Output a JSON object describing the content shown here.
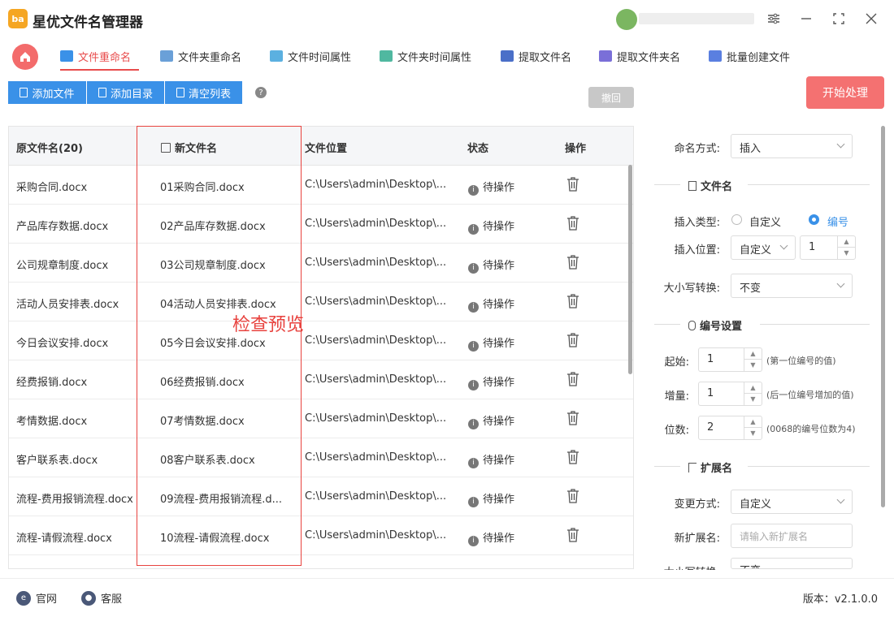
{
  "app": {
    "title": "星优文件名管理器",
    "logo_text": "ba"
  },
  "tabs": [
    {
      "label": "文件重命名",
      "color": "#3a91e8"
    },
    {
      "label": "文件夹重命名",
      "color": "#6aa0d8"
    },
    {
      "label": "文件时间属性",
      "color": "#5bb0e0"
    },
    {
      "label": "文件夹时间属性",
      "color": "#50b8a0"
    },
    {
      "label": "提取文件名",
      "color": "#4a6fc8"
    },
    {
      "label": "提取文件夹名",
      "color": "#7a6fd8"
    },
    {
      "label": "批量创建文件",
      "color": "#5a7fe0"
    }
  ],
  "toolbar": {
    "add_file": "添加文件",
    "add_dir": "添加目录",
    "clear_list": "清空列表",
    "help": "?",
    "undo": "撤回",
    "start": "开始处理"
  },
  "table": {
    "headers": {
      "original": "原文件名(20)",
      "new": "新文件名",
      "location": "文件位置",
      "status": "状态",
      "action": "操作"
    },
    "rows": [
      {
        "original": "采购合同.docx",
        "new": "01采购合同.docx",
        "location": "C:\\Users\\admin\\Desktop\\...",
        "status": "待操作"
      },
      {
        "original": "产品库存数据.docx",
        "new": "02产品库存数据.docx",
        "location": "C:\\Users\\admin\\Desktop\\...",
        "status": "待操作"
      },
      {
        "original": "公司规章制度.docx",
        "new": "03公司规章制度.docx",
        "location": "C:\\Users\\admin\\Desktop\\...",
        "status": "待操作"
      },
      {
        "original": "活动人员安排表.docx",
        "new": "04活动人员安排表.docx",
        "location": "C:\\Users\\admin\\Desktop\\...",
        "status": "待操作"
      },
      {
        "original": "今日会议安排.docx",
        "new": "05今日会议安排.docx",
        "location": "C:\\Users\\admin\\Desktop\\...",
        "status": "待操作"
      },
      {
        "original": "经费报销.docx",
        "new": "06经费报销.docx",
        "location": "C:\\Users\\admin\\Desktop\\...",
        "status": "待操作"
      },
      {
        "original": "考情数据.docx",
        "new": "07考情数据.docx",
        "location": "C:\\Users\\admin\\Desktop\\...",
        "status": "待操作"
      },
      {
        "original": "客户联系表.docx",
        "new": "08客户联系表.docx",
        "location": "C:\\Users\\admin\\Desktop\\...",
        "status": "待操作"
      },
      {
        "original": "流程-费用报销流程.docx",
        "new": "09流程-费用报销流程.d...",
        "location": "C:\\Users\\admin\\Desktop\\...",
        "status": "待操作"
      },
      {
        "original": "流程-请假流程.docx",
        "new": "10流程-请假流程.docx",
        "location": "C:\\Users\\admin\\Desktop\\...",
        "status": "待操作"
      }
    ]
  },
  "annotation": {
    "text": "检查预览",
    "color": "#e8433f"
  },
  "panel": {
    "naming_label": "命名方式:",
    "naming_value": "插入",
    "filename_section": "文件名",
    "insert_type_label": "插入类型:",
    "insert_type_custom": "自定义",
    "insert_type_number": "编号",
    "insert_pos_label": "插入位置:",
    "insert_pos_value": "自定义",
    "insert_pos_num": "1",
    "case_label": "大小写转换:",
    "case_value": "不变",
    "number_section": "编号设置",
    "start_label": "起始:",
    "start_value": "1",
    "start_hint": "(第一位编号的值)",
    "inc_label": "增量:",
    "inc_value": "1",
    "inc_hint": "(后一位编号增加的值)",
    "digits_label": "位数:",
    "digits_value": "2",
    "digits_hint": "(0068的编号位数为4)",
    "ext_section": "扩展名",
    "ext_mode_label": "变更方式:",
    "ext_mode_value": "自定义",
    "ext_new_label": "新扩展名:",
    "ext_new_placeholder": "请输入新扩展名",
    "ext_case_label": "大小写转换:",
    "ext_case_value": "不变"
  },
  "footer": {
    "website": "官网",
    "service": "客服",
    "version": "版本：v2.1.0.0"
  }
}
